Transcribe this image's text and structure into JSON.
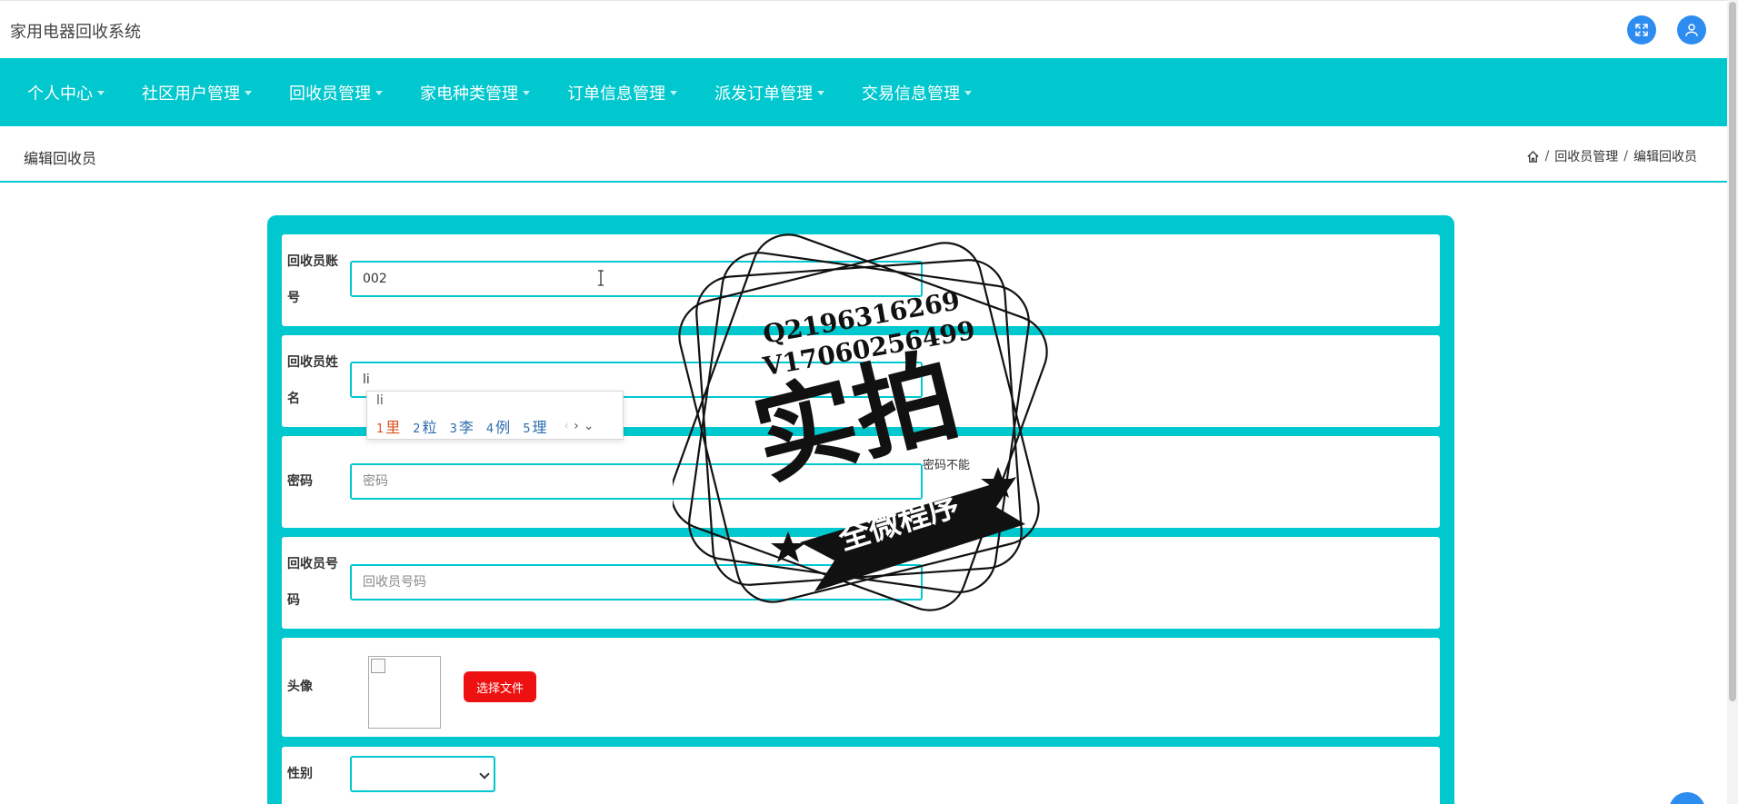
{
  "header": {
    "app_title": "家用电器回收系统"
  },
  "nav": {
    "items": [
      {
        "label": "个人中心"
      },
      {
        "label": "社区用户管理"
      },
      {
        "label": "回收员管理"
      },
      {
        "label": "家电种类管理"
      },
      {
        "label": "订单信息管理"
      },
      {
        "label": "派发订单管理"
      },
      {
        "label": "交易信息管理"
      }
    ]
  },
  "page": {
    "title": "编辑回收员",
    "breadcrumb": [
      "回收员管理",
      "编辑回收员"
    ],
    "breadcrumb_sep": "/"
  },
  "form": {
    "account": {
      "label": "回收员账号",
      "value": "002"
    },
    "name": {
      "label": "回收员姓名",
      "value": "li"
    },
    "password": {
      "label": "密码",
      "placeholder": "密码",
      "hint": "密码不能"
    },
    "phone": {
      "label": "回收员号码",
      "placeholder": "回收员号码"
    },
    "avatar": {
      "label": "头像",
      "button": "选择文件"
    },
    "gender": {
      "label": "性别",
      "value": ""
    }
  },
  "ime": {
    "composition": "li",
    "candidates": [
      {
        "num": "1",
        "text": "里"
      },
      {
        "num": "2",
        "text": "粒"
      },
      {
        "num": "3",
        "text": "李"
      },
      {
        "num": "4",
        "text": "例"
      },
      {
        "num": "5",
        "text": "理"
      }
    ]
  },
  "watermark": {
    "line1": "Q2196316269",
    "line2": "V17060256499",
    "main": "实拍",
    "banner": "全微程序"
  },
  "colors": {
    "accent": "#00c8ce",
    "icon_blue": "#2d8cf0",
    "file_button": "#ee1111"
  }
}
